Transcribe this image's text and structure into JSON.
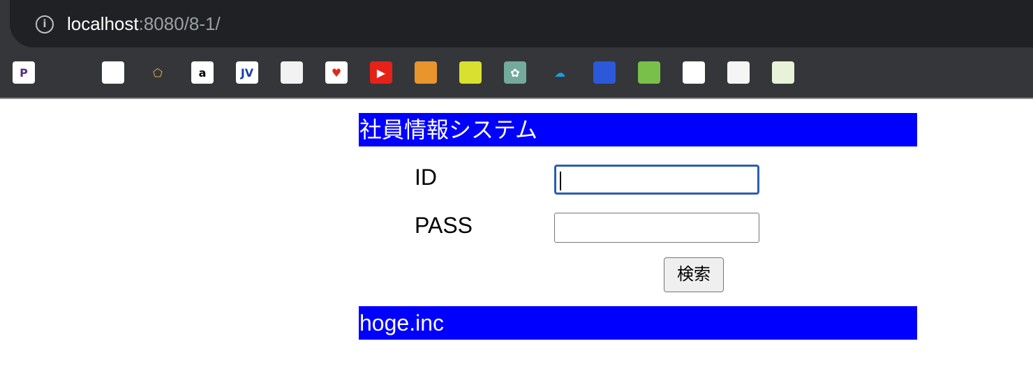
{
  "browser": {
    "url_host": "localhost",
    "url_path": ":8080/8-1/",
    "info_icon": "info-icon",
    "bookmarks": [
      {
        "name": "bookmark-p-icon",
        "glyph": "P",
        "bg": "#ffffff",
        "fg": "#5b2a86"
      },
      {
        "name": "github-icon",
        "glyph": "",
        "bg": "#35363a",
        "fg": "#ffffff"
      },
      {
        "name": "bookmark-dark-icon",
        "glyph": "",
        "bg": "#ffffff",
        "fg": "#cc2222"
      },
      {
        "name": "pentagon-icon",
        "glyph": "⬠",
        "bg": "#35363a",
        "fg": "#e9b949"
      },
      {
        "name": "amazon-icon",
        "glyph": "a",
        "bg": "#ffffff",
        "fg": "#000000"
      },
      {
        "name": "bookmark-jv-icon",
        "glyph": "JV",
        "bg": "#ffffff",
        "fg": "#1a3fa8"
      },
      {
        "name": "bookmark-doc-icon",
        "glyph": "",
        "bg": "#f2f2f2",
        "fg": "#888888"
      },
      {
        "name": "rainbow-heart-icon",
        "glyph": "♥",
        "bg": "#ffffff",
        "fg": "#e2281e"
      },
      {
        "name": "youtube-icon",
        "glyph": "▶",
        "bg": "#e62117",
        "fg": "#ffffff"
      },
      {
        "name": "package-icon",
        "glyph": "",
        "bg": "#e8952e",
        "fg": "#ffffff"
      },
      {
        "name": "bookmark-circle-icon",
        "glyph": "",
        "bg": "#d8e030",
        "fg": "#ffffff"
      },
      {
        "name": "chatgpt-icon",
        "glyph": "✿",
        "bg": "#74aa9c",
        "fg": "#ffffff"
      },
      {
        "name": "salesforce-icon",
        "glyph": "☁",
        "bg": "#35363a",
        "fg": "#1ba0e1"
      },
      {
        "name": "bookmark-flag-icon",
        "glyph": "",
        "bg": "#2b59d9",
        "fg": "#ffffff"
      },
      {
        "name": "bookmark-green-circle-icon",
        "glyph": "",
        "bg": "#78c04a",
        "fg": "#ffffff"
      },
      {
        "name": "bookmark-white-icon",
        "glyph": "",
        "bg": "#ffffff",
        "fg": "#555555"
      },
      {
        "name": "bookmark-raksul-icon",
        "glyph": "",
        "bg": "#f5f5f5",
        "fg": "#e87c1e"
      },
      {
        "name": "bookmark-sukkiri-icon",
        "glyph": "",
        "bg": "#e8f2d8",
        "fg": "#7ab648"
      }
    ]
  },
  "page": {
    "header_title": "社員情報システム",
    "id_label": "ID",
    "pass_label": "PASS",
    "id_value": "",
    "pass_value": "",
    "search_button": "検索",
    "footer_text": "hoge.inc",
    "colors": {
      "banner_bg": "#0000ff",
      "banner_text": "#ffffff"
    }
  }
}
